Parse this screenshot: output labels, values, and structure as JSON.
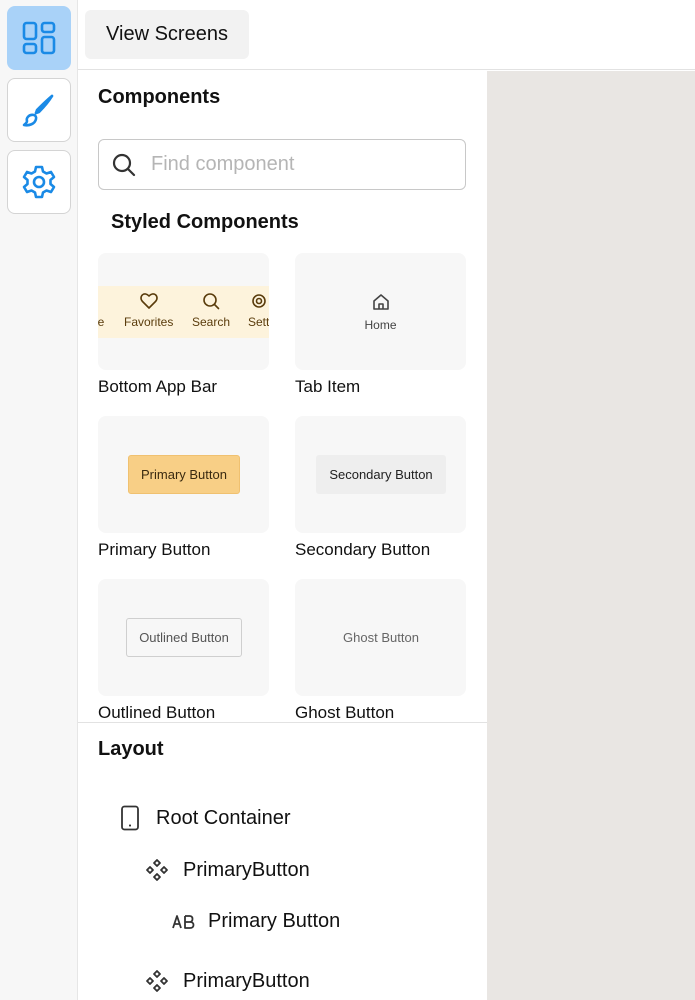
{
  "sidebar": {
    "items": [
      {
        "name": "components",
        "icon": "layout-grid-icon",
        "active": true
      },
      {
        "name": "theme",
        "icon": "paint-brush-icon",
        "active": false
      },
      {
        "name": "settings",
        "icon": "gear-icon",
        "active": false
      }
    ]
  },
  "toolbar": {
    "view_screens_label": "View Screens"
  },
  "components": {
    "title": "Components",
    "search": {
      "placeholder": "Find component",
      "value": ""
    },
    "section_title": "Styled Components",
    "cards": [
      {
        "label": "Bottom App Bar"
      },
      {
        "label": "Tab Item"
      },
      {
        "label": "Primary Button"
      },
      {
        "label": "Secondary Button"
      },
      {
        "label": "Outlined Button"
      },
      {
        "label": "Ghost Button"
      }
    ],
    "bottom_app_bar_items": [
      "e",
      "Favorites",
      "Search",
      "Sett"
    ],
    "tab_item_label": "Home",
    "primary_button_text": "Primary Button",
    "secondary_button_text": "Secondary Button",
    "outlined_button_text": "Outlined Button",
    "ghost_button_text": "Ghost Button"
  },
  "layout": {
    "title": "Layout",
    "tree": [
      {
        "label": "Root Container",
        "icon": "mobile-device-icon",
        "depth": 0
      },
      {
        "label": "PrimaryButton",
        "icon": "component-icon",
        "depth": 1
      },
      {
        "label": "Primary Button",
        "icon": "text-ab-icon",
        "depth": 2
      },
      {
        "label": "PrimaryButton",
        "icon": "component-icon",
        "depth": 1
      }
    ]
  },
  "colors": {
    "accent_blue": "#1a8ae6",
    "active_rail_bg": "#a9d2f8",
    "primary_button_bg": "#f8cf86",
    "bottom_bar_bg": "#fdf3dc",
    "canvas_bg": "#e9e6e3"
  }
}
